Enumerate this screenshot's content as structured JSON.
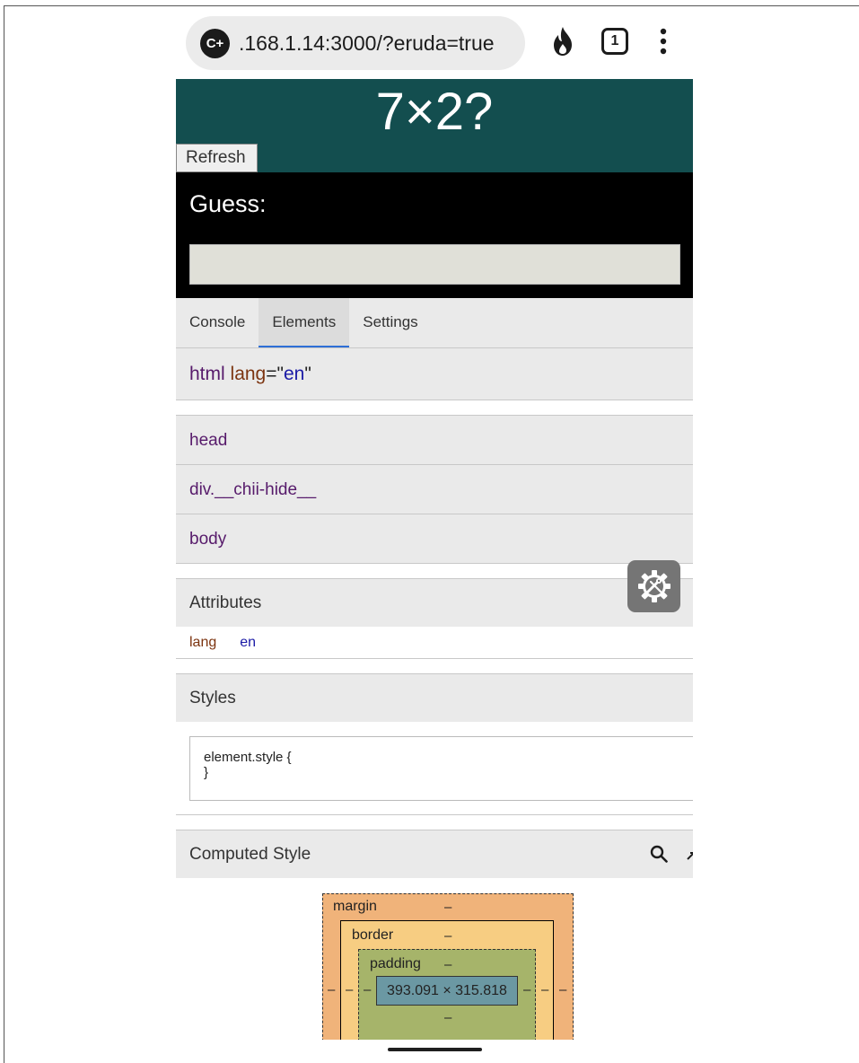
{
  "browser": {
    "site_badge": "C+",
    "url": ".168.1.14:3000/?eruda=true",
    "tab_count": "1"
  },
  "app": {
    "question": "7×2?",
    "refresh_label": "Refresh",
    "guess_label": "Guess:",
    "guess_value": ""
  },
  "devtools": {
    "tabs": [
      "Console",
      "Elements",
      "Settings"
    ],
    "active_tab": "Elements",
    "selected": {
      "tag": "html",
      "attr_name": "lang",
      "attr_value": "en"
    },
    "children": [
      "head",
      "div.__chii-hide__",
      "body"
    ],
    "attributes_title": "Attributes",
    "attributes": [
      {
        "name": "lang",
        "value": "en"
      }
    ],
    "styles_title": "Styles",
    "style_open": "element.style {",
    "style_close": "}",
    "computed_title": "Computed Style",
    "box_model": {
      "margin_label": "margin",
      "border_label": "border",
      "padding_label": "padding",
      "dash": "–",
      "content": "393.091 × 315.818"
    }
  },
  "icons": {
    "site": "site-badge-icon",
    "flame": "flame-icon",
    "tabs": "tab-switcher-icon",
    "menu": "kebab-menu-icon",
    "devtools_toggle": "gear-tools-icon",
    "search": "search-icon",
    "expand": "expand-icon"
  },
  "colors": {
    "header_bg": "#134e4f",
    "guess_bg": "#000000",
    "tag": "#571b6b",
    "attr_name": "#7c3410",
    "attr_value": "#1a1aa6",
    "active_tab_underline": "#2e6fd6"
  }
}
